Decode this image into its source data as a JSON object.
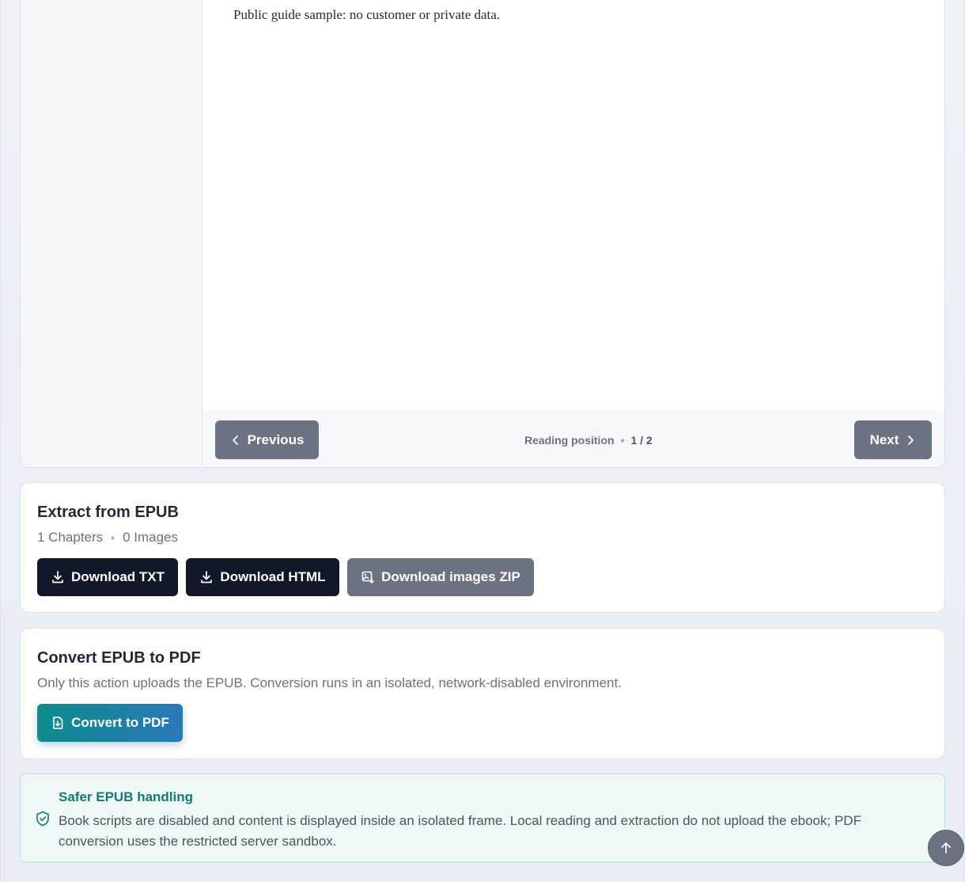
{
  "reader": {
    "text": "Public guide sample: no customer or private data.",
    "prev_label": "Previous",
    "next_label": "Next",
    "position_label": "Reading position",
    "position_value": "1 / 2"
  },
  "extract": {
    "title": "Extract from EPUB",
    "chapters": "1 Chapters",
    "images": "0 Images",
    "download_txt": "Download TXT",
    "download_html": "Download HTML",
    "download_zip": "Download images ZIP"
  },
  "convert": {
    "title": "Convert EPUB to PDF",
    "description": "Only this action uploads the EPUB. Conversion runs in an isolated, network-disabled environment.",
    "button": "Convert to PDF"
  },
  "safety": {
    "title": "Safer EPUB handling",
    "text": "Book scripts are disabled and content is displayed inside an isolated frame. Local reading and extraction do not upload the ebook; PDF conversion uses the restricted server sandbox."
  },
  "icons": {
    "prev": "chevron-left-icon",
    "next": "chevron-right-icon",
    "download": "download-icon",
    "image_zip": "image-download-icon",
    "pdf": "file-download-icon",
    "shield": "shield-check-icon",
    "scroll_top": "arrow-up-icon"
  },
  "colors": {
    "dark_button": "#111827",
    "gray_button": "#6b7280",
    "accent_teal": "#0f8c8c",
    "accent_blue": "#2a78b8",
    "safety_title": "#167a6f",
    "safety_bg": "#eef8f7"
  }
}
